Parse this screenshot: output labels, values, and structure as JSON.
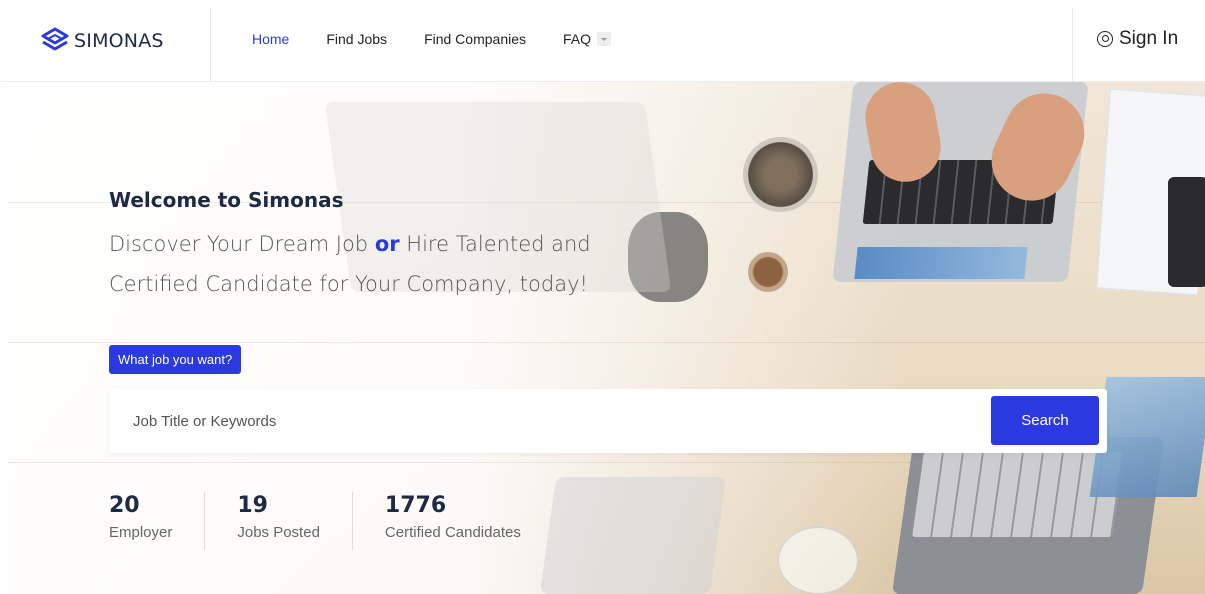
{
  "header": {
    "logo_text": "SIMONAS",
    "nav": [
      {
        "label": "Home",
        "active": true
      },
      {
        "label": "Find Jobs",
        "active": false
      },
      {
        "label": "Find Companies",
        "active": false
      },
      {
        "label": "FAQ",
        "active": false
      }
    ],
    "signin_label": "Sign In"
  },
  "hero": {
    "welcome": "Welcome to Simonas",
    "tagline_part1": "Discover Your Dream Job ",
    "tagline_or": "or",
    "tagline_part2": " Hire Talented and Certified Candidate for Your Company, today!",
    "badge": "What job you want?",
    "search": {
      "placeholder": "Job Title or Keywords",
      "value": "",
      "button_label": "Search"
    },
    "stats": [
      {
        "number": "20",
        "label": "Employer"
      },
      {
        "number": "19",
        "label": "Jobs Posted"
      },
      {
        "number": "1776",
        "label": "Certified Candidates"
      }
    ]
  },
  "colors": {
    "accent": "#2a3ae0",
    "heading": "#1c2a43"
  },
  "icons": [
    "logo-icon",
    "user-circle-icon",
    "chevron-down-icon"
  ]
}
